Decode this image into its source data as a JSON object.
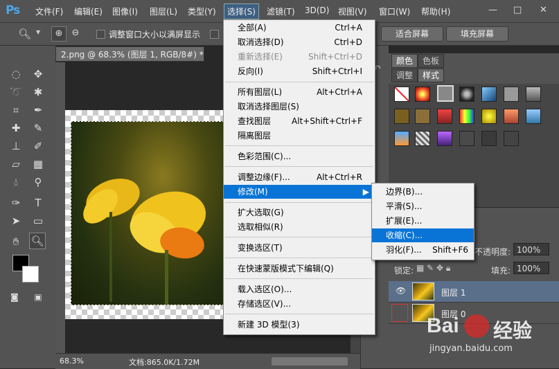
{
  "menubar": {
    "logo": "Ps",
    "items": [
      "文件(F)",
      "编辑(E)",
      "图像(I)",
      "图层(L)",
      "类型(Y)",
      "选择(S)",
      "滤镜(T)",
      "3D(D)",
      "视图(V)",
      "窗口(W)",
      "帮助(H)"
    ],
    "window_controls": [
      "—",
      "□",
      "✕"
    ]
  },
  "options": {
    "resize_windows_label": "调整窗口大小以满屏显示",
    "fit_screen_label": "适合屏幕",
    "fill_screen_label": "填充屏幕"
  },
  "document": {
    "tab_title": "2.png @ 68.3% (图层 1, RGB/8#) *",
    "zoom": "68.3%",
    "doc_size": "文档:865.0K/1.72M"
  },
  "select_menu": {
    "items": [
      {
        "label": "全部(A)",
        "shortcut": "Ctrl+A"
      },
      {
        "label": "取消选择(D)",
        "shortcut": "Ctrl+D"
      },
      {
        "label": "重新选择(E)",
        "shortcut": "Shift+Ctrl+D",
        "disabled": true
      },
      {
        "label": "反向(I)",
        "shortcut": "Shift+Ctrl+I"
      },
      {
        "label": "所有图层(L)",
        "shortcut": "Alt+Ctrl+A"
      },
      {
        "label": "取消选择图层(S)",
        "shortcut": ""
      },
      {
        "label": "查找图层",
        "shortcut": "Alt+Shift+Ctrl+F"
      },
      {
        "label": "隔离图层",
        "shortcut": ""
      },
      {
        "label": "色彩范围(C)...",
        "shortcut": ""
      },
      {
        "label": "调整边缘(F)...",
        "shortcut": "Alt+Ctrl+R"
      },
      {
        "label": "修改(M)",
        "shortcut": ""
      },
      {
        "label": "扩大选取(G)",
        "shortcut": ""
      },
      {
        "label": "选取相似(R)",
        "shortcut": ""
      },
      {
        "label": "变换选区(T)",
        "shortcut": ""
      },
      {
        "label": "在快速蒙版模式下编辑(Q)",
        "shortcut": ""
      },
      {
        "label": "载入选区(O)...",
        "shortcut": ""
      },
      {
        "label": "存储选区(V)...",
        "shortcut": ""
      },
      {
        "label": "新建 3D 模型(3)",
        "shortcut": ""
      }
    ]
  },
  "modify_submenu": {
    "items": [
      {
        "label": "边界(B)...",
        "shortcut": ""
      },
      {
        "label": "平滑(S)...",
        "shortcut": ""
      },
      {
        "label": "扩展(E)...",
        "shortcut": ""
      },
      {
        "label": "收缩(C)...",
        "shortcut": ""
      },
      {
        "label": "羽化(F)...",
        "shortcut": "Shift+F6"
      }
    ]
  },
  "panels": {
    "color_tab": "颜色",
    "swatches_tab": "色板",
    "adjustments_tab": "调整",
    "styles_tab": "样式"
  },
  "layers": {
    "opacity_label": "不透明度:",
    "opacity_value": "100%",
    "lock_label": "锁定:",
    "fill_label": "填充:",
    "fill_value": "100%",
    "rows": [
      {
        "name": "图层 1"
      },
      {
        "name": "图层 0"
      }
    ]
  },
  "watermark": {
    "brand": "Bai",
    "brand2": "经验",
    "url": "jingyan.baidu.com"
  },
  "colors": {
    "highlight": "#0a74d6",
    "ui_bg": "#535353",
    "menu_bg": "#f0f0f0"
  }
}
